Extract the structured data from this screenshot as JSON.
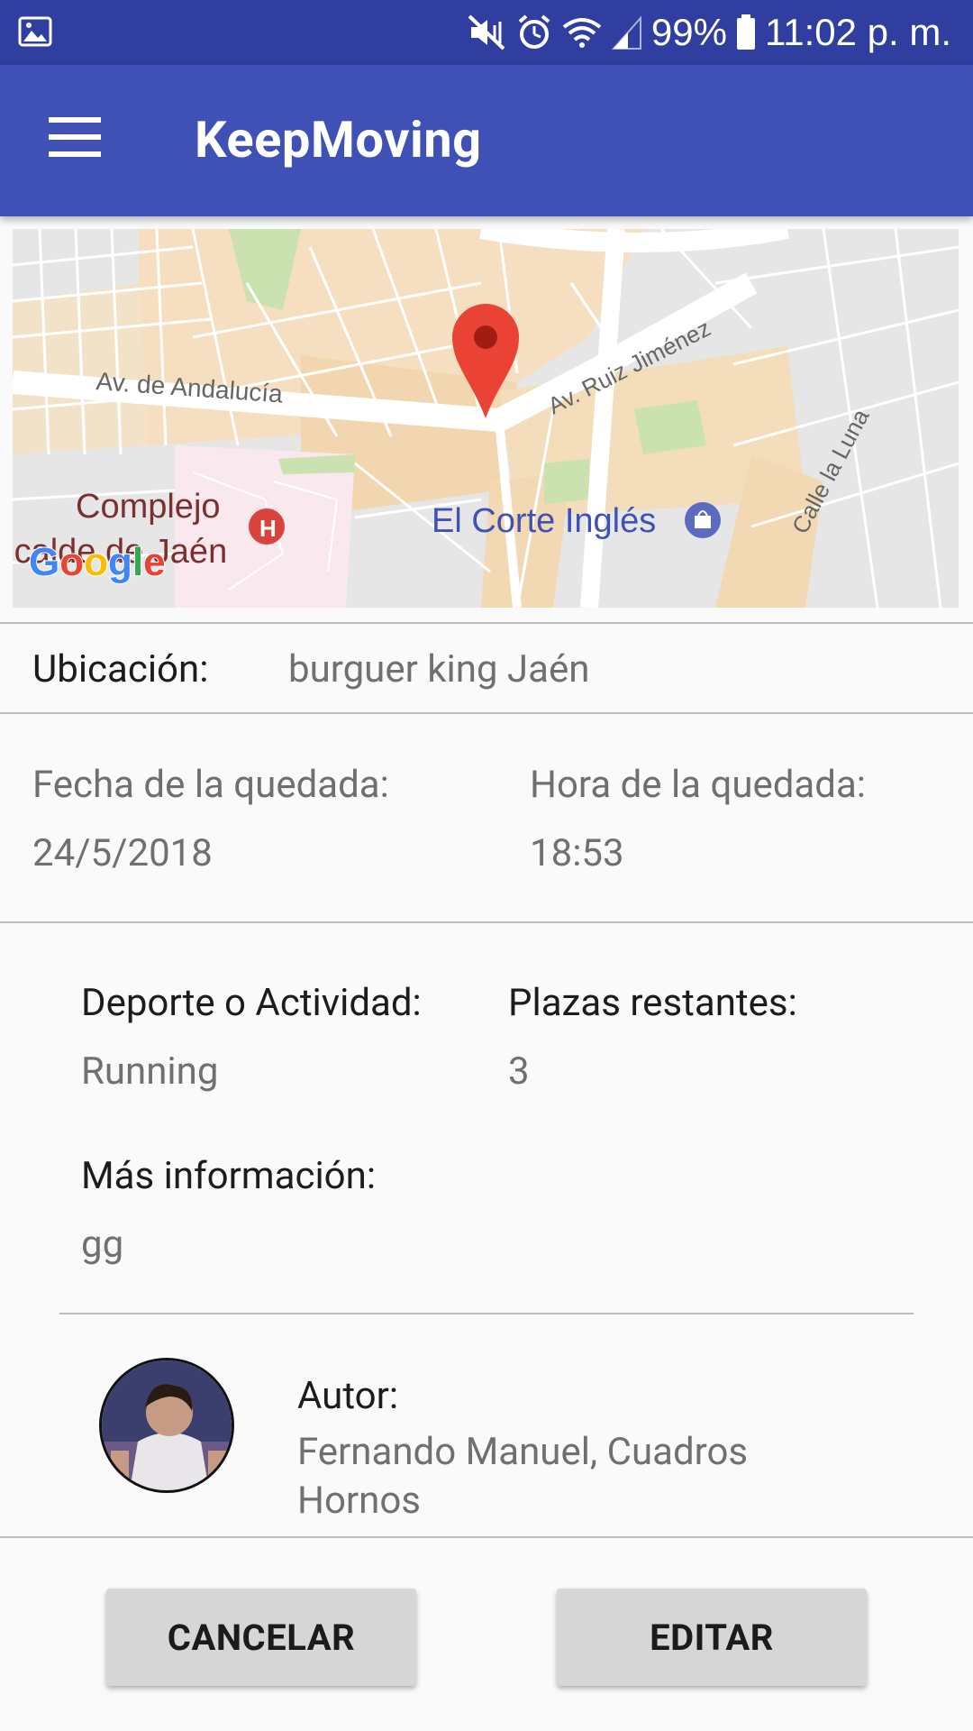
{
  "status_bar": {
    "battery": "99%",
    "time": "11:02 p. m.",
    "icons": [
      "image-icon",
      "mute-vibrate-icon",
      "alarm-icon",
      "wifi-icon",
      "signal-icon",
      "battery-icon"
    ]
  },
  "app_bar": {
    "title": "KeepMoving",
    "menu_icon": "hamburger-menu-icon",
    "color": "#3f51b5"
  },
  "map": {
    "streets": [
      "Av. de Andalucía",
      "Av. Ruiz Jiménez",
      "Calle la Luna"
    ],
    "places": [
      "Complejo",
      "alcalde de Jaén",
      "El Corte Inglés"
    ],
    "logo": "Google",
    "marker_color": "#ea4335"
  },
  "location": {
    "label": "Ubicación:",
    "value": "burguer king Jaén"
  },
  "date": {
    "label": "Fecha de la quedada:",
    "value": "24/5/2018"
  },
  "time": {
    "label": "Hora de la quedada:",
    "value": "18:53"
  },
  "sport": {
    "label": "Deporte o Actividad:",
    "value": "Running"
  },
  "spots": {
    "label": "Plazas restantes:",
    "value": "3"
  },
  "more_info": {
    "label": "Más información:",
    "value": "gg"
  },
  "author": {
    "label": "Autor:",
    "name_line1": "Fernando Manuel, Cuadros",
    "name_line2": "Hornos"
  },
  "buttons": {
    "cancel": "CANCELAR",
    "edit": "EDITAR"
  }
}
